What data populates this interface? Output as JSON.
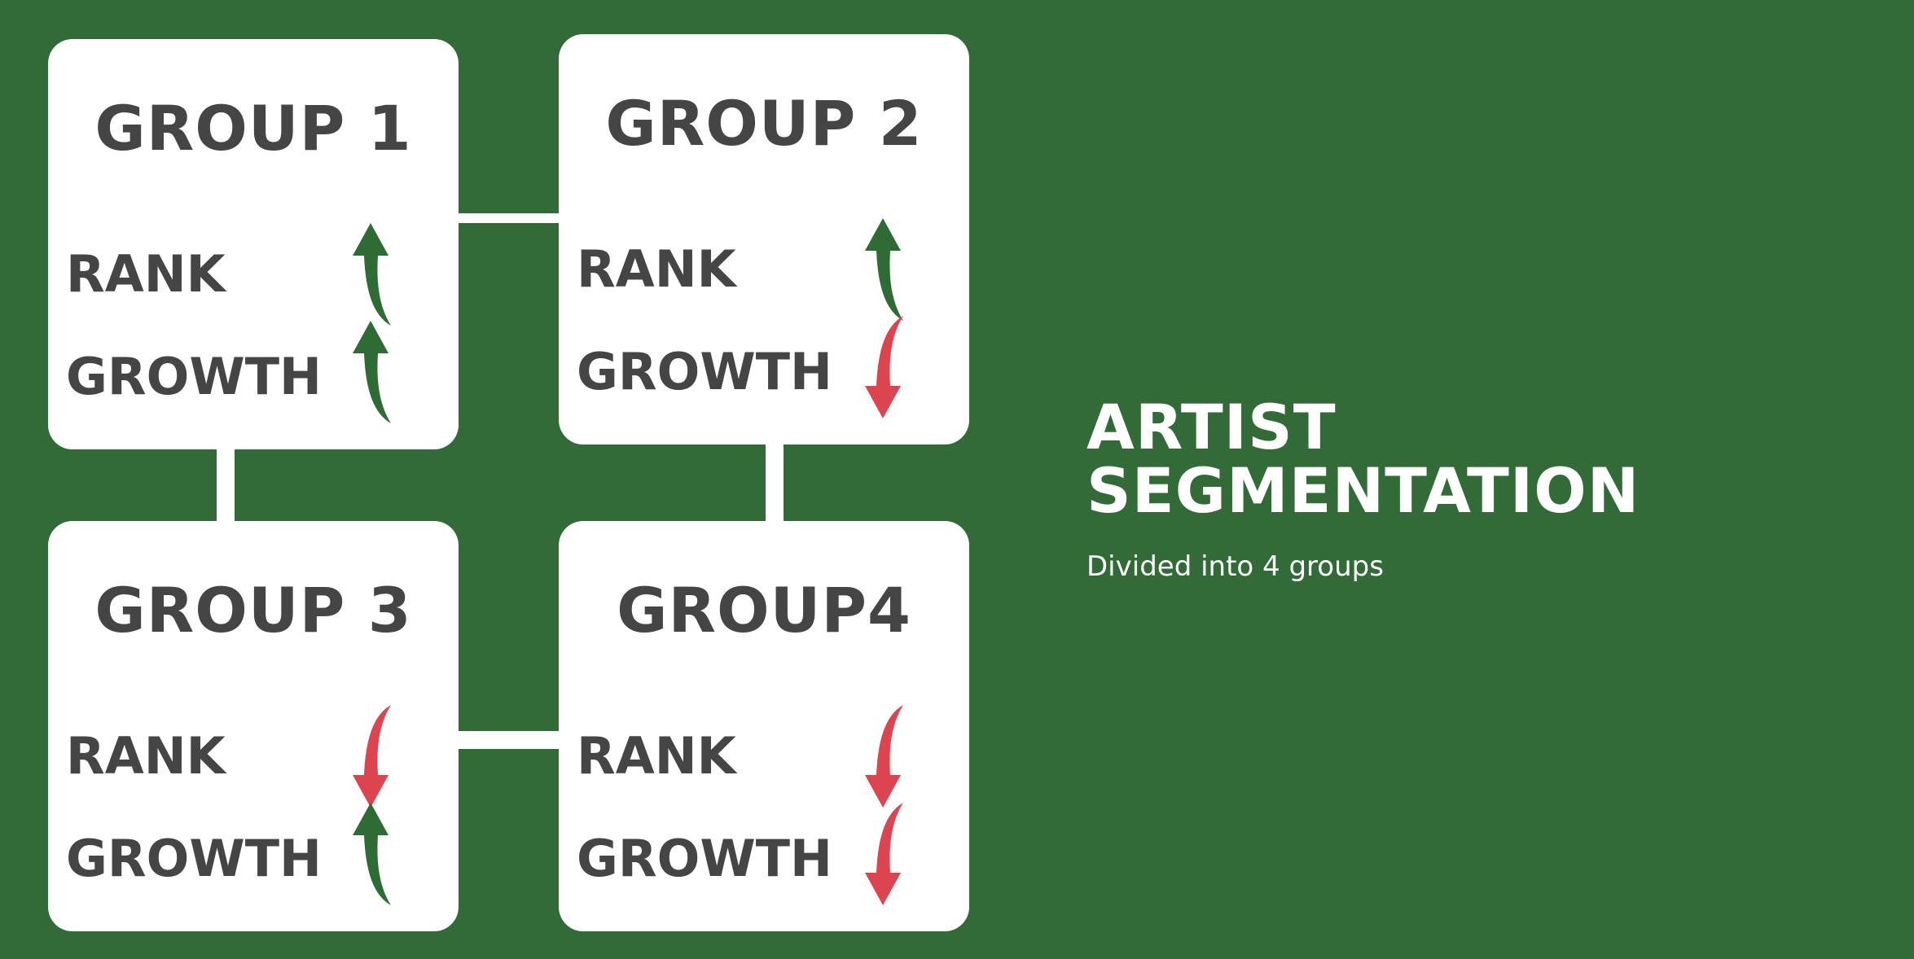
{
  "colors": {
    "background": "#326b37",
    "card": "#ffffff",
    "text_dark": "#454545",
    "up": "#2e6b35",
    "down": "#dc4550"
  },
  "groups": [
    {
      "title": "GROUP 1",
      "metrics": [
        {
          "label": "RANK",
          "trend": "up",
          "icon": "arrow-up-icon"
        },
        {
          "label": "GROWTH",
          "trend": "up",
          "icon": "arrow-up-icon"
        }
      ]
    },
    {
      "title": "GROUP 2",
      "metrics": [
        {
          "label": "RANK",
          "trend": "up",
          "icon": "arrow-up-icon"
        },
        {
          "label": "GROWTH",
          "trend": "down",
          "icon": "arrow-down-icon"
        }
      ]
    },
    {
      "title": "GROUP 3",
      "metrics": [
        {
          "label": "RANK",
          "trend": "down",
          "icon": "arrow-down-icon"
        },
        {
          "label": "GROWTH",
          "trend": "up",
          "icon": "arrow-up-icon"
        }
      ]
    },
    {
      "title": "GROUP4",
      "metrics": [
        {
          "label": "RANK",
          "trend": "down",
          "icon": "arrow-down-icon"
        },
        {
          "label": "GROWTH",
          "trend": "down",
          "icon": "arrow-down-icon"
        }
      ]
    }
  ],
  "heading": {
    "line1": "ARTIST",
    "line2": "SEGMENTATION",
    "subtitle": "Divided into 4 groups"
  }
}
